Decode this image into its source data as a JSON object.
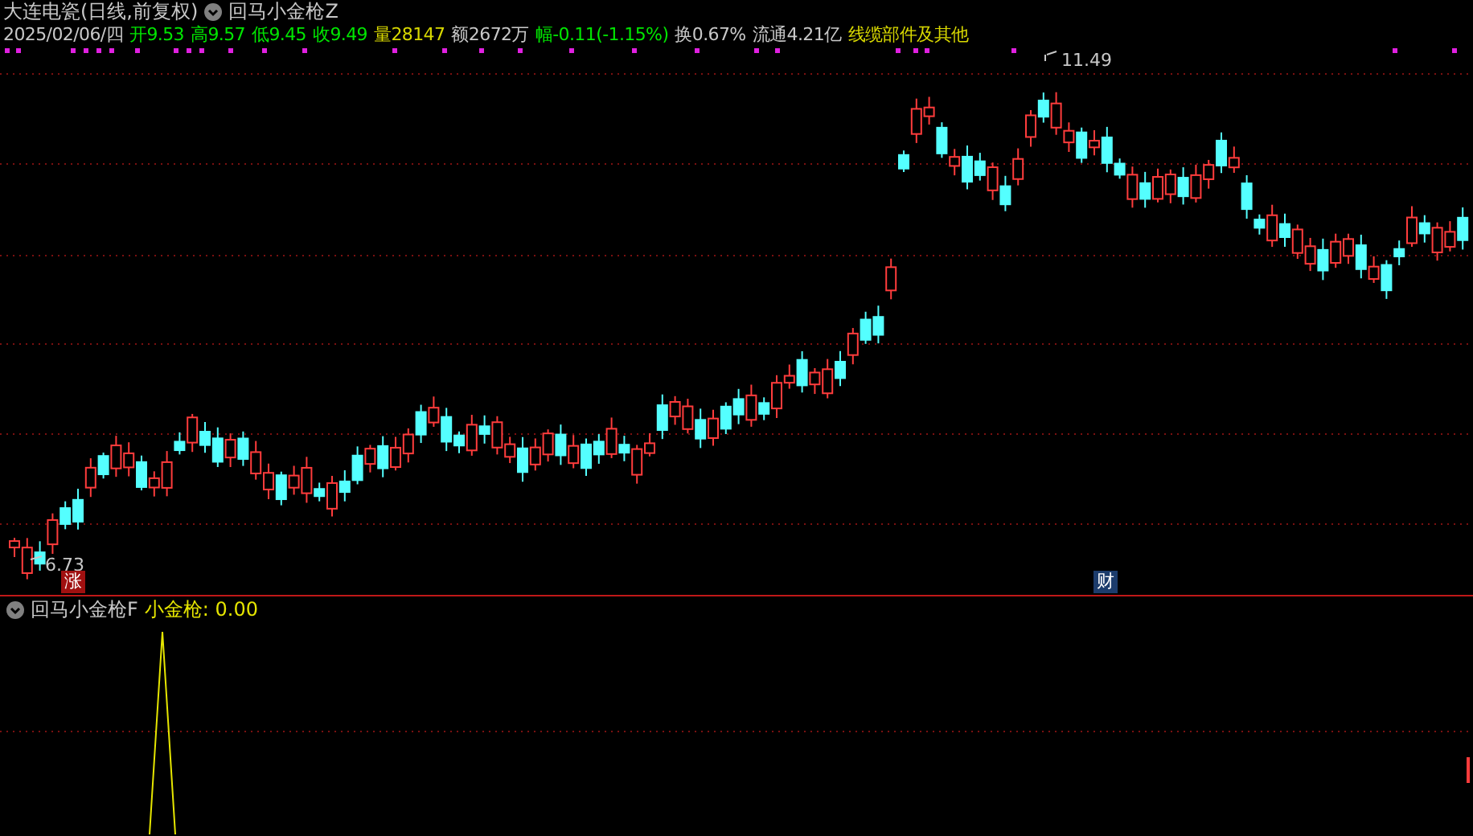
{
  "header": {
    "title": "大连电瓷(日线,前复权)",
    "indicator": "回马小金枪Z"
  },
  "quote": [
    {
      "text": "2025/02/06/四",
      "color": "#c8c8c8"
    },
    {
      "text": "开9.53",
      "color": "#00e600"
    },
    {
      "text": "高9.57",
      "color": "#00e600"
    },
    {
      "text": "低9.45",
      "color": "#00e600"
    },
    {
      "text": "收9.49",
      "color": "#00e600"
    },
    {
      "text": "量28147",
      "color": "#d8d800"
    },
    {
      "text": "额2672万",
      "color": "#c8c8c8"
    },
    {
      "text": "幅-0.11(-1.15%)",
      "color": "#00e600"
    },
    {
      "text": "换0.67%",
      "color": "#c8c8c8"
    },
    {
      "text": "流通4.21亿",
      "color": "#c8c8c8"
    },
    {
      "text": "线缆部件及其他",
      "color": "#d8d800"
    }
  ],
  "main_chart": {
    "high_label": "11.49",
    "low_label": "6.73",
    "markers": [
      {
        "text": "涨",
        "kind": "rise"
      },
      {
        "text": "财",
        "kind": "finance"
      }
    ]
  },
  "sub_panel": {
    "indicator": "回马小金枪F",
    "reading": "小金枪: 0.00"
  }
}
